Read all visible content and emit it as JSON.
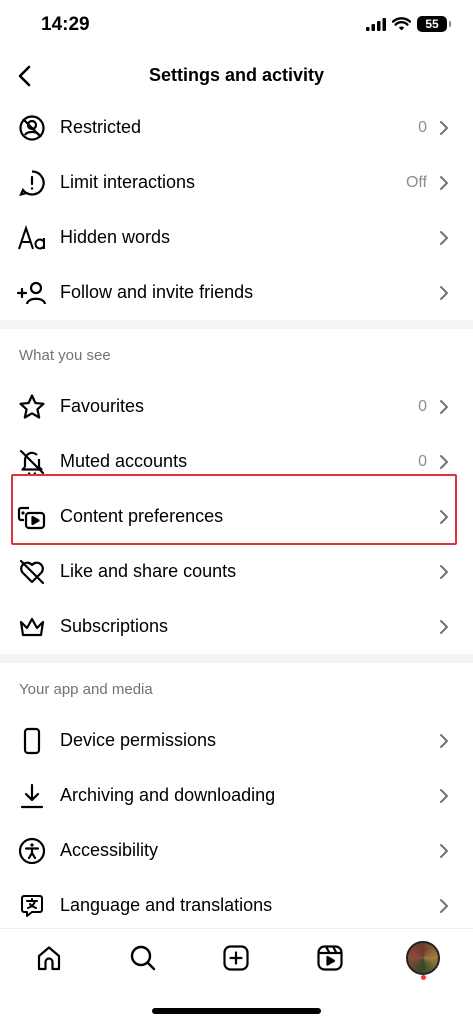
{
  "status": {
    "time": "14:29",
    "battery": "55"
  },
  "header": {
    "title": "Settings and activity"
  },
  "sections": {
    "top": [
      {
        "label": "Restricted",
        "value": "0"
      },
      {
        "label": "Limit interactions",
        "value": "Off"
      },
      {
        "label": "Hidden words",
        "value": ""
      },
      {
        "label": "Follow and invite friends",
        "value": ""
      }
    ],
    "what_you_see": {
      "title": "What you see",
      "items": [
        {
          "label": "Favourites",
          "value": "0"
        },
        {
          "label": "Muted accounts",
          "value": "0"
        },
        {
          "label": "Content preferences",
          "value": ""
        },
        {
          "label": "Like and share counts",
          "value": ""
        },
        {
          "label": "Subscriptions",
          "value": ""
        }
      ]
    },
    "your_app": {
      "title": "Your app and media",
      "items": [
        {
          "label": "Device permissions",
          "value": ""
        },
        {
          "label": "Archiving and downloading",
          "value": ""
        },
        {
          "label": "Accessibility",
          "value": ""
        },
        {
          "label": "Language and translations",
          "value": ""
        }
      ]
    }
  },
  "icons": {
    "top": [
      "restricted-icon",
      "limit-interactions-icon",
      "hidden-words-icon",
      "follow-invite-icon"
    ],
    "what_you_see": [
      "star-icon",
      "muted-bell-icon",
      "content-preferences-icon",
      "heart-off-icon",
      "crown-icon"
    ],
    "your_app": [
      "phone-icon",
      "download-icon",
      "accessibility-icon",
      "translate-icon"
    ]
  },
  "tabbar": [
    "home-icon",
    "search-icon",
    "create-icon",
    "reels-icon",
    "profile-avatar"
  ]
}
